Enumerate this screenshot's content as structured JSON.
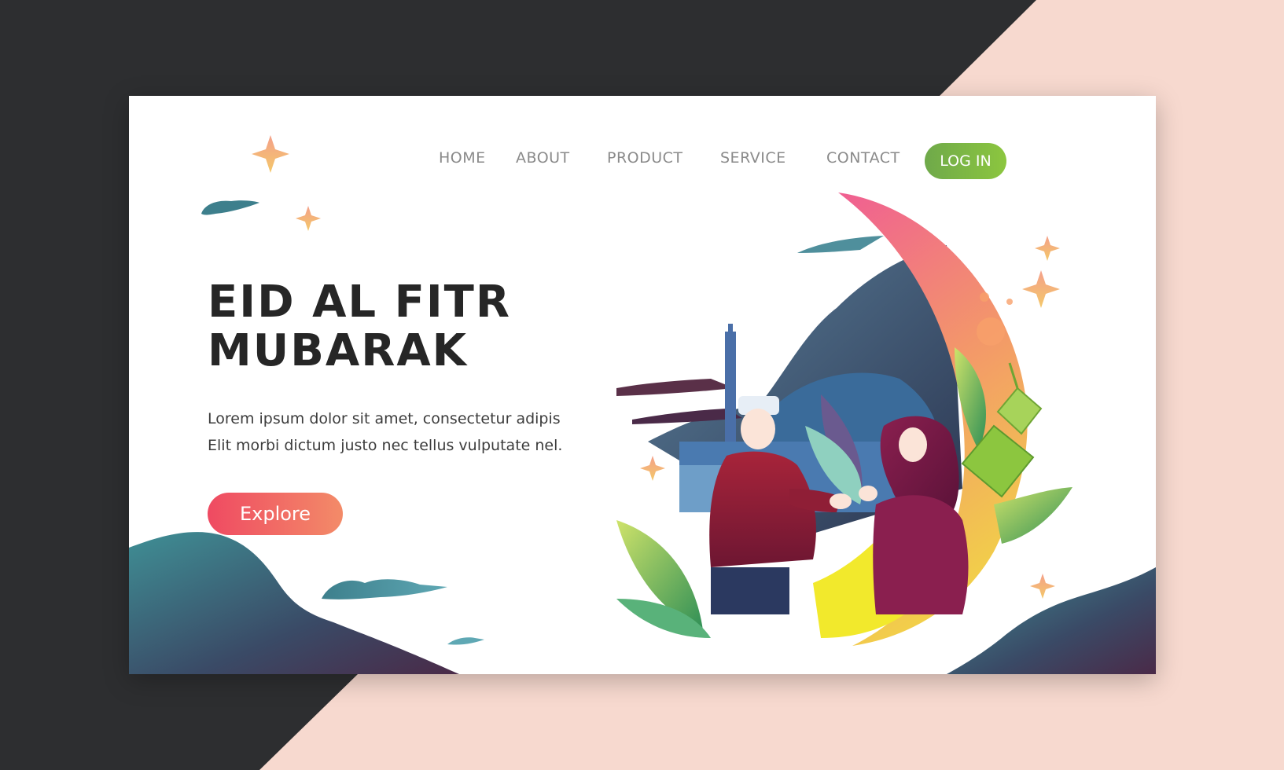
{
  "nav": {
    "items": [
      {
        "label": "HOME"
      },
      {
        "label": "ABOUT"
      },
      {
        "label": "PRODUCT"
      },
      {
        "label": "SERVICE"
      },
      {
        "label": "CONTACT"
      }
    ],
    "login_label": "LOG IN"
  },
  "hero": {
    "title_line1": "EID AL FITR",
    "title_line2": "MUBARAK",
    "desc_line1": "Lorem ipsum dolor sit amet, consectetur adipis",
    "desc_line2": "Elit morbi dictum justo nec tellus vulputate nel.",
    "cta_label": "Explore"
  },
  "colors": {
    "accent_green": "#8cc63f",
    "accent_red": "#ef4a62",
    "dark_background": "#2d2e30",
    "peach_background": "#f7d9cf"
  },
  "icons": [
    "sparkle-star-icon",
    "crescent-moon-icon",
    "ketupat-icon",
    "mosque-icon"
  ]
}
